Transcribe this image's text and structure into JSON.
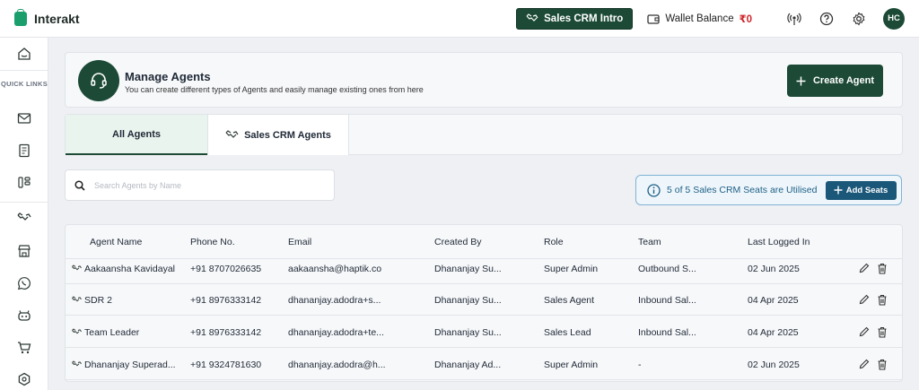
{
  "app": {
    "name": "Interakt"
  },
  "topbar": {
    "crm_intro_label": "Sales CRM Intro",
    "wallet_label": "Wallet Balance",
    "wallet_amount": "₹0",
    "avatar_initials": "HC"
  },
  "sidebar": {
    "quick_links_label": "QUICK LINKS"
  },
  "header": {
    "title": "Manage Agents",
    "subtitle": "You can create different types of Agents and easily manage existing ones from here",
    "create_label": "Create Agent"
  },
  "tabs": [
    {
      "label": "All Agents"
    },
    {
      "label": "Sales CRM Agents"
    }
  ],
  "search": {
    "placeholder": "Search Agents by Name"
  },
  "seats": {
    "text": "5 of 5 Sales CRM Seats are Utilised",
    "add_label": "Add Seats"
  },
  "table": {
    "columns": [
      "Agent Name",
      "Phone No.",
      "Email",
      "Created By",
      "Role",
      "Team",
      "Last Logged In"
    ],
    "rows": [
      {
        "name": "Aakaansha Kavidayal",
        "phone": "+91 8707026635",
        "email": "aakaansha@haptik.co",
        "created_by": "Dhananjay Su...",
        "role": "Super Admin",
        "team": "Outbound S...",
        "last_login": "02 Jun 2025"
      },
      {
        "name": "SDR 2",
        "phone": "+91 8976333142",
        "email": "dhananjay.adodra+s...",
        "created_by": "Dhananjay Su...",
        "role": "Sales Agent",
        "team": "Inbound Sal...",
        "last_login": "04 Apr 2025"
      },
      {
        "name": "Team Leader",
        "phone": "+91 8976333142",
        "email": "dhananjay.adodra+te...",
        "created_by": "Dhananjay Su...",
        "role": "Sales Lead",
        "team": "Inbound Sal...",
        "last_login": "04 Apr 2025"
      },
      {
        "name": "Dhananjay Superad...",
        "phone": "+91 9324781630",
        "email": "dhananjay.adodra@h...",
        "created_by": "Dhananjay Ad...",
        "role": "Super Admin",
        "team": "-",
        "last_login": "02 Jun 2025"
      }
    ]
  },
  "colors": {
    "brand": "#1c4a36",
    "accent_green": "#1a9e6c",
    "seats_blue": "#1b5779",
    "wallet_red": "#d0262b"
  }
}
